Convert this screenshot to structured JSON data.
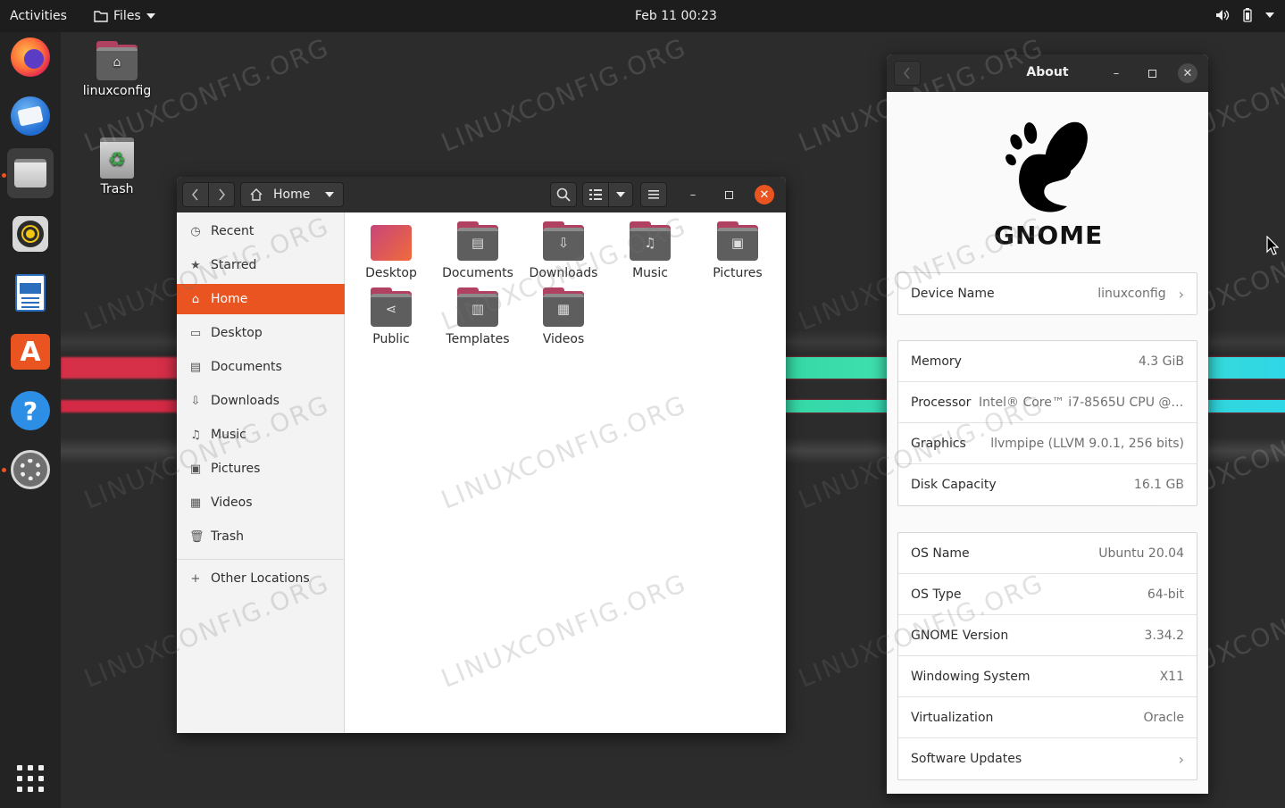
{
  "topbar": {
    "activities": "Activities",
    "app_menu": "Files",
    "clock": "Feb 11  00:23"
  },
  "dock": {
    "items": [
      "firefox-icon",
      "thunderbird-icon",
      "files-icon",
      "rhythmbox-icon",
      "libreoffice-writer-icon",
      "software-icon",
      "help-icon",
      "settings-icon",
      "show-apps-icon"
    ]
  },
  "desktop": {
    "home_icon_label": "linuxconfig",
    "trash_icon_label": "Trash",
    "watermark": "LINUXCONFIG.ORG"
  },
  "files": {
    "location": "Home",
    "sidebar": [
      {
        "label": "Recent",
        "icon": "clock-icon"
      },
      {
        "label": "Starred",
        "icon": "star-icon"
      },
      {
        "label": "Home",
        "icon": "home-icon"
      },
      {
        "label": "Desktop",
        "icon": "desktop-icon"
      },
      {
        "label": "Documents",
        "icon": "document-icon"
      },
      {
        "label": "Downloads",
        "icon": "download-icon"
      },
      {
        "label": "Music",
        "icon": "music-icon"
      },
      {
        "label": "Pictures",
        "icon": "picture-icon"
      },
      {
        "label": "Videos",
        "icon": "video-icon"
      },
      {
        "label": "Trash",
        "icon": "trash-icon"
      }
    ],
    "other_locations": "Other Locations",
    "folders": [
      "Desktop",
      "Documents",
      "Downloads",
      "Music",
      "Pictures",
      "Public",
      "Templates",
      "Videos"
    ]
  },
  "about": {
    "title": "About",
    "logo_text": "GNOME",
    "device": {
      "label": "Device Name",
      "value": "linuxconfig"
    },
    "hardware": [
      {
        "label": "Memory",
        "value": "4.3 GiB"
      },
      {
        "label": "Processor",
        "value": "Intel® Core™ i7-8565U CPU @ 1..."
      },
      {
        "label": "Graphics",
        "value": "llvmpipe (LLVM 9.0.1, 256 bits)"
      },
      {
        "label": "Disk Capacity",
        "value": "16.1 GB"
      }
    ],
    "software": [
      {
        "label": "OS Name",
        "value": "Ubuntu 20.04"
      },
      {
        "label": "OS Type",
        "value": "64-bit"
      },
      {
        "label": "GNOME Version",
        "value": "3.34.2"
      },
      {
        "label": "Windowing System",
        "value": "X11"
      },
      {
        "label": "Virtualization",
        "value": "Oracle"
      },
      {
        "label": "Software Updates",
        "value": ""
      }
    ]
  },
  "colors": {
    "accent": "#e95420",
    "headerbar": "#2d2d2d",
    "folder_tab": "#b04160"
  }
}
